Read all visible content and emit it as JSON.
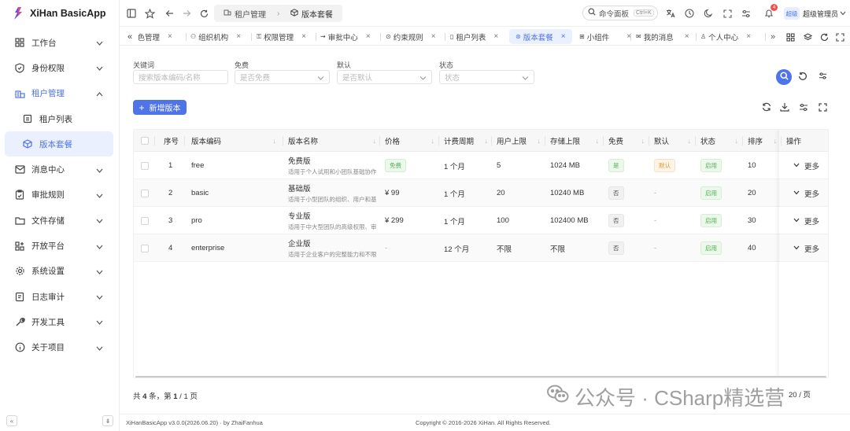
{
  "app": {
    "title": "XiHan BasicApp"
  },
  "sidebar": {
    "items": [
      {
        "label": "工作台",
        "icon": "dashboard-icon"
      },
      {
        "label": "身份权限",
        "icon": "shield-icon"
      },
      {
        "label": "租户管理",
        "icon": "building-icon"
      },
      {
        "label": "租户列表",
        "icon": "list-icon"
      },
      {
        "label": "版本套餐",
        "icon": "package-icon"
      },
      {
        "label": "消息中心",
        "icon": "mail-icon"
      },
      {
        "label": "审批规则",
        "icon": "clipboard-icon"
      },
      {
        "label": "文件存储",
        "icon": "folder-icon"
      },
      {
        "label": "开放平台",
        "icon": "grid-plus-icon"
      },
      {
        "label": "系统设置",
        "icon": "gear-icon"
      },
      {
        "label": "日志审计",
        "icon": "log-icon"
      },
      {
        "label": "开发工具",
        "icon": "wrench-icon"
      },
      {
        "label": "关于项目",
        "icon": "info-icon"
      }
    ],
    "collapse_icon": "«",
    "pin_icon": "⇟"
  },
  "header": {
    "breadcrumb": [
      "租户管理",
      "版本套餐"
    ],
    "search_label": "命令面板",
    "search_shortcut": "Ctrl+K",
    "notification_count": "4",
    "user_badge": "超级",
    "user_name": "超级管理员"
  },
  "tabs": [
    {
      "label": "角色管理"
    },
    {
      "label": "组织机构"
    },
    {
      "label": "权限管理"
    },
    {
      "label": "审批中心"
    },
    {
      "label": "约束规则"
    },
    {
      "label": "租户列表"
    },
    {
      "label": "版本套餐"
    },
    {
      "label": "小组件"
    },
    {
      "label": "我的消息"
    },
    {
      "label": "个人中心"
    }
  ],
  "filters": {
    "keyword": {
      "label": "关键词",
      "placeholder": "搜索版本编码/名称"
    },
    "free": {
      "label": "免费",
      "placeholder": "是否免费"
    },
    "default": {
      "label": "默认",
      "placeholder": "是否默认"
    },
    "status": {
      "label": "状态",
      "placeholder": "状态"
    }
  },
  "toolbar": {
    "add_label": "新增版本"
  },
  "table": {
    "columns": [
      "序号",
      "版本编码",
      "版本名称",
      "价格",
      "计费周期",
      "用户上限",
      "存储上限",
      "免费",
      "默认",
      "状态",
      "排序",
      "操作"
    ],
    "rows": [
      {
        "no": "1",
        "code": "free",
        "name": "免费版",
        "desc": "适用于个人试用和小团队基础协作",
        "price": "免费",
        "price_tag": true,
        "cycle": "1 个月",
        "users": "5",
        "storage": "1024 MB",
        "free": "是",
        "free_tag": "green",
        "default": "默认",
        "default_tag": "orange",
        "status": "启用",
        "sort": "10",
        "op": "更多"
      },
      {
        "no": "2",
        "code": "basic",
        "name": "基础版",
        "desc": "适用于小型团队的组织、用户和基础权限管理",
        "price": "¥ 99",
        "price_tag": false,
        "cycle": "1 个月",
        "users": "20",
        "storage": "10240 MB",
        "free": "否",
        "free_tag": "gray",
        "default": "-",
        "default_tag": "none",
        "status": "启用",
        "sort": "20",
        "op": "更多"
      },
      {
        "no": "3",
        "code": "pro",
        "name": "专业版",
        "desc": "适用于中大型团队的高级权限、审批与开放能力",
        "price": "¥ 299",
        "price_tag": false,
        "cycle": "1 个月",
        "users": "100",
        "storage": "102400 MB",
        "free": "否",
        "free_tag": "gray",
        "default": "-",
        "default_tag": "none",
        "status": "启用",
        "sort": "30",
        "op": "更多"
      },
      {
        "no": "4",
        "code": "enterprise",
        "name": "企业版",
        "desc": "适用于企业客户的完整能力和不限规模部署",
        "price": "-",
        "price_tag": false,
        "cycle": "12 个月",
        "users": "不限",
        "storage": "不限",
        "free": "否",
        "free_tag": "gray",
        "default": "-",
        "default_tag": "none",
        "status": "启用",
        "sort": "40",
        "op": "更多"
      }
    ]
  },
  "pagination": {
    "prefix": "共 ",
    "total": "4",
    "mid": " 条，第 ",
    "page": "1",
    "sep": " / ",
    "pages": "1",
    "suffix": " 页",
    "page_size": "20 / 页"
  },
  "watermark": {
    "text": "公众号 · CSharp精选营"
  },
  "footer": {
    "version": "XiHanBasicApp v3.0.0(2026.06.20) · by ZhaiFanhua",
    "copyright": "Copyright © 2016-2026 XiHan. All Rights Reserved."
  },
  "colors": {
    "primary": "#4f74e8",
    "success": "#52b152",
    "warning": "#e09a3b",
    "danger": "#f04e4e"
  }
}
